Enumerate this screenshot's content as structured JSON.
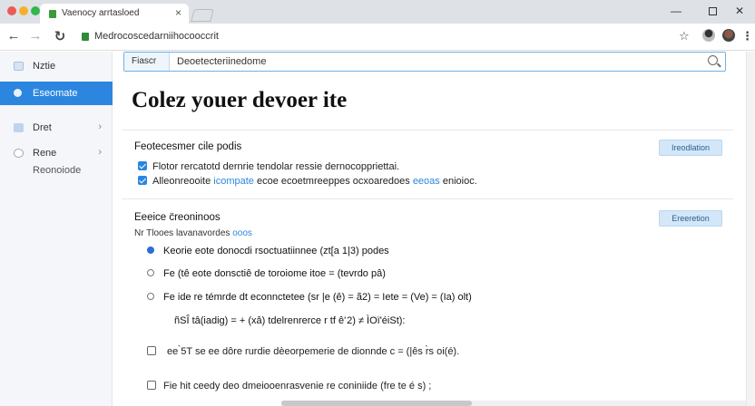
{
  "browser": {
    "tab_title": "Vaenocy arrtasloed",
    "tab_close": "×",
    "url": "Medrocoscedarniihocooccrit",
    "traffic_colors": [
      "#ec5b55",
      "#f5b02b",
      "#33b74b"
    ],
    "window_min": "—",
    "window_close": "✕",
    "nav_back": "←",
    "nav_forward": "→",
    "nav_reload": "↻",
    "bookmark_icon": "☆",
    "menu_icon": "⋮",
    "accent_color": "#2c86e0"
  },
  "sidebar": {
    "items": [
      {
        "label": "Nztie",
        "icon": "user-icon",
        "active": false
      },
      {
        "label": "Eseomate",
        "icon": "cloud-icon",
        "active": true
      },
      {
        "label": "Dret",
        "icon": "grid-icon",
        "active": false,
        "chevron": "›"
      },
      {
        "label": "Rene",
        "icon": "settings-icon",
        "active": false,
        "chevron": "›"
      }
    ],
    "sub_label": "Reonoiode"
  },
  "search": {
    "scope_label": "Fiascr",
    "value": "Deoetecteriinedome"
  },
  "page": {
    "title": "Colez youer devoer ite"
  },
  "section1": {
    "title": "Feotecesmer cile podis",
    "button": "Ireodlation",
    "options": [
      {
        "text": "Flotor rercatotd dernrie tendolar ressie dernocoppriettai.",
        "checked": true
      },
      {
        "text_a": "Alleonreooite ",
        "link": "icompate",
        "text_b": " ecoe ecoetmreeppes ocxoaredoes ",
        "link2": "eeoas",
        "text_c": " enioioc.",
        "checked": true
      }
    ]
  },
  "section2": {
    "title": "Eeeice c̈reoninoos",
    "button": "Ereeretion",
    "hint_a": "Nr Tlooes lavanavordes ",
    "hint_link": "ooos",
    "radios": [
      {
        "text": "Keorie  eote donocdi rsoctuatiinnee (zt[a 1|3) podes",
        "selected": true
      },
      {
        "text": "Fe (tê  eote donsctiê de toroiome itoe = (tevrdo pâ)",
        "selected": false
      },
      {
        "text": "Fe ide  re témrde dt econnctetee (sr |e (ê) = ã2) = Iete = (Ve) = (Ia) olt)",
        "selected": false
      }
    ],
    "formula": "ñSÎ  tâ(iadig) = + (xâ) tdelrenrerce r tf  ê' 2) ≠ ÌOï'éiSt):",
    "checks": [
      {
        "prefix": "ee ̀5T",
        "text": "  se ee dôre rurdie dèeorpemerie de dionnde c = (|ês  r̀s oi(é).",
        "checked": false
      },
      {
        "prefix": "Fie hit",
        "text": "  ceedy deo dmeiooenrasvenie re coniniide (fre te é s) ;",
        "checked": false
      }
    ]
  }
}
